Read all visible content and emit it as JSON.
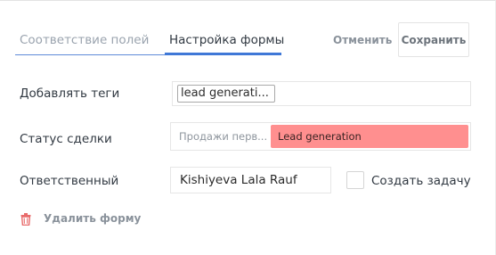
{
  "tabs": {
    "mapping_label": "Соответствие полей",
    "form_label": "Настройка формы"
  },
  "header": {
    "cancel_label": "Отменить",
    "save_label": "Сохранить"
  },
  "fields": {
    "tags": {
      "label": "Добавлять теги",
      "chip": "lead generati..."
    },
    "status": {
      "label": "Статус сделки",
      "pipeline": "Продажи перв...",
      "stage": "Lead generation",
      "stage_color": "#ff8f8f"
    },
    "responsible": {
      "label": "Ответственный",
      "value": "Kishiyeva Lala Rauf"
    },
    "task": {
      "label": "Создать задачу",
      "checked": false
    }
  },
  "actions": {
    "delete_label": "Удалить форму",
    "delete_icon": "trash-icon",
    "delete_icon_color": "#e86b6b"
  },
  "colors": {
    "accent": "#3f78d7"
  }
}
